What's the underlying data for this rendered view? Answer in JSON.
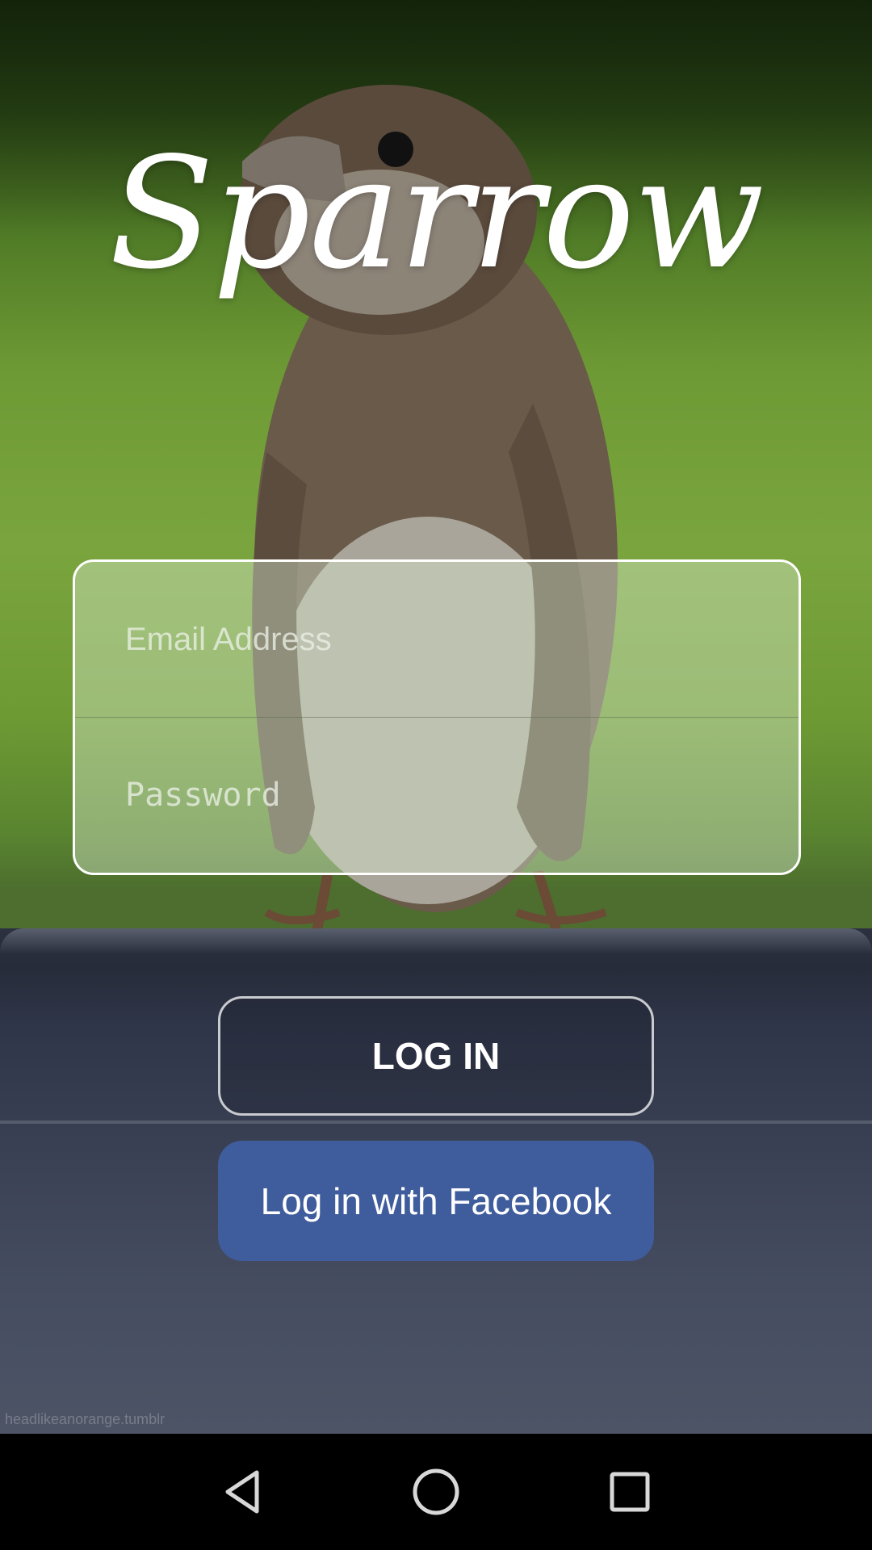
{
  "app": {
    "logo_text": "Sparrow"
  },
  "login_form": {
    "email": {
      "value": "",
      "placeholder": "Email Address"
    },
    "password": {
      "value": "",
      "placeholder": "Password"
    }
  },
  "buttons": {
    "login_label": "LOG IN",
    "facebook_label": "Log in with Facebook"
  },
  "background": {
    "photo_credit": "headlikeanorange.tumblr"
  },
  "nav_bar": {
    "back_icon": "back-triangle-icon",
    "home_icon": "home-circle-icon",
    "recents_icon": "recents-square-icon"
  },
  "colors": {
    "facebook_blue": "#3f5c9c",
    "card_border": "#ffffff",
    "login_border": "#c9cbd0"
  }
}
